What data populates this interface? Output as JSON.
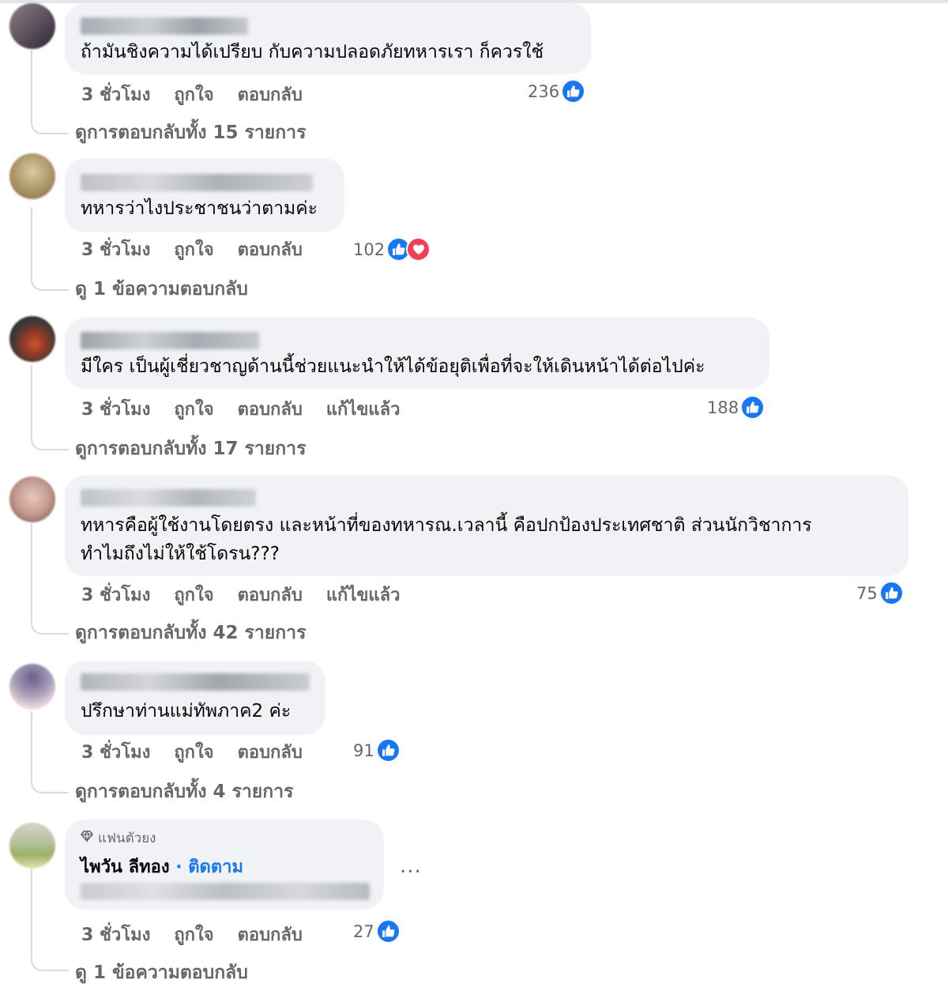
{
  "comments": [
    {
      "text_lines": [
        "ถ้ามันชิงความได้เปรียบ กับความปลอดภัยทหารเรา ก็ควรใช้"
      ],
      "actions": {
        "time": "3 ชั่วโมง",
        "like": "ถูกใจ",
        "reply": "ตอบกลับ",
        "edited": ""
      },
      "reactions": {
        "count": "236",
        "types": [
          "like-icon"
        ]
      },
      "view_replies": "ดูการตอบกลับทั้ง 15 รายการ"
    },
    {
      "text_lines": [
        "ทหารว่าไงประชาชนว่าตามค่ะ"
      ],
      "actions": {
        "time": "3 ชั่วโมง",
        "like": "ถูกใจ",
        "reply": "ตอบกลับ",
        "edited": ""
      },
      "reactions": {
        "count": "102",
        "types": [
          "like-icon",
          "love-icon"
        ]
      },
      "view_replies": "ดู 1 ข้อความตอบกลับ"
    },
    {
      "text_lines": [
        "มีใคร เป็นผู้เชี่ยวชาญด้านนี้ช่วยแนะนำให้ได้ข้อยุติเพื่อที่จะให้เดินหน้าได้ต่อไปค่ะ"
      ],
      "actions": {
        "time": "3 ชั่วโมง",
        "like": "ถูกใจ",
        "reply": "ตอบกลับ",
        "edited": "แก้ไขแล้ว"
      },
      "reactions": {
        "count": "188",
        "types": [
          "like-icon"
        ]
      },
      "view_replies": "ดูการตอบกลับทั้ง 17 รายการ"
    },
    {
      "text_lines": [
        "ทหารคือผู้ใช้งานโดยตรง และหน้าที่ของทหารณ.เวลานี้ คือปกป้องประเทศชาติ ส่วนนักวิชาการ",
        "ทำไมถึงไม่ให้ใช้โดรน???"
      ],
      "actions": {
        "time": "3 ชั่วโมง",
        "like": "ถูกใจ",
        "reply": "ตอบกลับ",
        "edited": "แก้ไขแล้ว"
      },
      "reactions": {
        "count": "75",
        "types": [
          "like-icon"
        ]
      },
      "view_replies": "ดูการตอบกลับทั้ง 42 รายการ"
    },
    {
      "text_lines": [
        "ปรึกษาท่านแม่ทัพภาค2 ค่ะ"
      ],
      "actions": {
        "time": "3 ชั่วโมง",
        "like": "ถูกใจ",
        "reply": "ตอบกลับ",
        "edited": ""
      },
      "reactions": {
        "count": "91",
        "types": [
          "like-icon"
        ]
      },
      "view_replies": "ดูการตอบกลับทั้ง 4 รายการ"
    },
    {
      "badge": "แฟนตัวยง",
      "author": "ไพวัน ลีทอง",
      "separator": "·",
      "follow": "ติดตาม",
      "more": "...",
      "actions": {
        "time": "3 ชั่วโมง",
        "like": "ถูกใจ",
        "reply": "ตอบกลับ",
        "edited": ""
      },
      "reactions": {
        "count": "27",
        "types": [
          "like-icon"
        ]
      },
      "view_replies": "ดู 1 ข้อความตอบกลับ"
    }
  ],
  "colors": {
    "like": "#1877f2",
    "love": "#f33e58",
    "bubble": "#f0f2f5",
    "secondary_text": "#65676b",
    "link": "#1877f2"
  }
}
